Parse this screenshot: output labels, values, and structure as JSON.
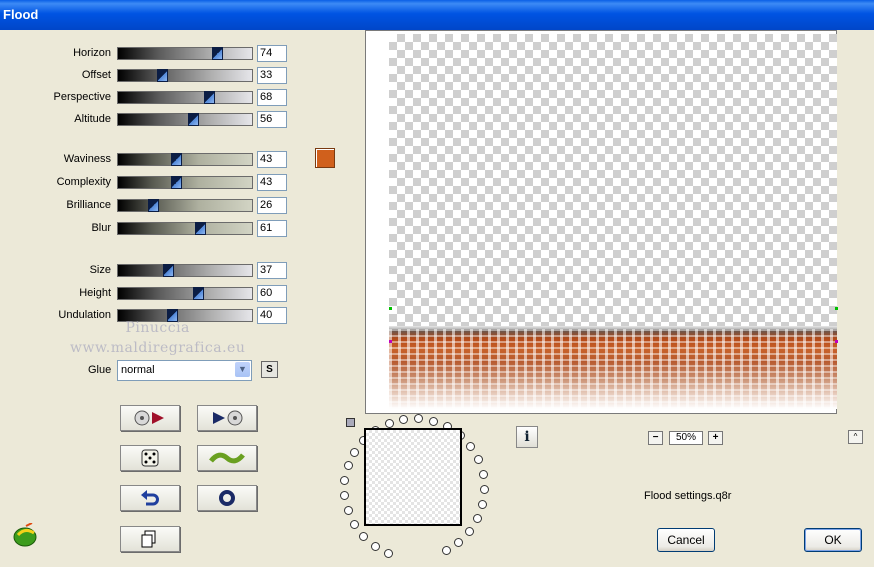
{
  "window": {
    "title": "Flood"
  },
  "sliders_group1": [
    {
      "label": "Horizon",
      "value": "74"
    },
    {
      "label": "Offset",
      "value": "33"
    },
    {
      "label": "Perspective",
      "value": "68"
    },
    {
      "label": "Altitude",
      "value": "56"
    }
  ],
  "sliders_group2": [
    {
      "label": "Waviness",
      "value": "43"
    },
    {
      "label": "Complexity",
      "value": "43"
    },
    {
      "label": "Brilliance",
      "value": "26"
    },
    {
      "label": "Blur",
      "value": "61"
    }
  ],
  "sliders_group3": [
    {
      "label": "Size",
      "value": "37"
    },
    {
      "label": "Height",
      "value": "60"
    },
    {
      "label": "Undulation",
      "value": "40"
    }
  ],
  "color_swatch": "#d0601c",
  "glue": {
    "label": "Glue",
    "value": "normal",
    "s_button": "S"
  },
  "watermark": {
    "line1": "Pinuccia",
    "line2": "www.maldiregrafica.eu"
  },
  "toolbar_icons": [
    "prev-preset-icon",
    "next-preset-icon",
    "dice-icon",
    "wave-icon",
    "undo-icon",
    "reset-icon",
    "copy-icon"
  ],
  "preview": {
    "zoom": "50%",
    "zoom_minus": "−",
    "zoom_plus": "+",
    "info": "i",
    "up": "^"
  },
  "settings_file": "Flood settings.q8r",
  "buttons": {
    "cancel": "Cancel",
    "ok": "OK"
  }
}
